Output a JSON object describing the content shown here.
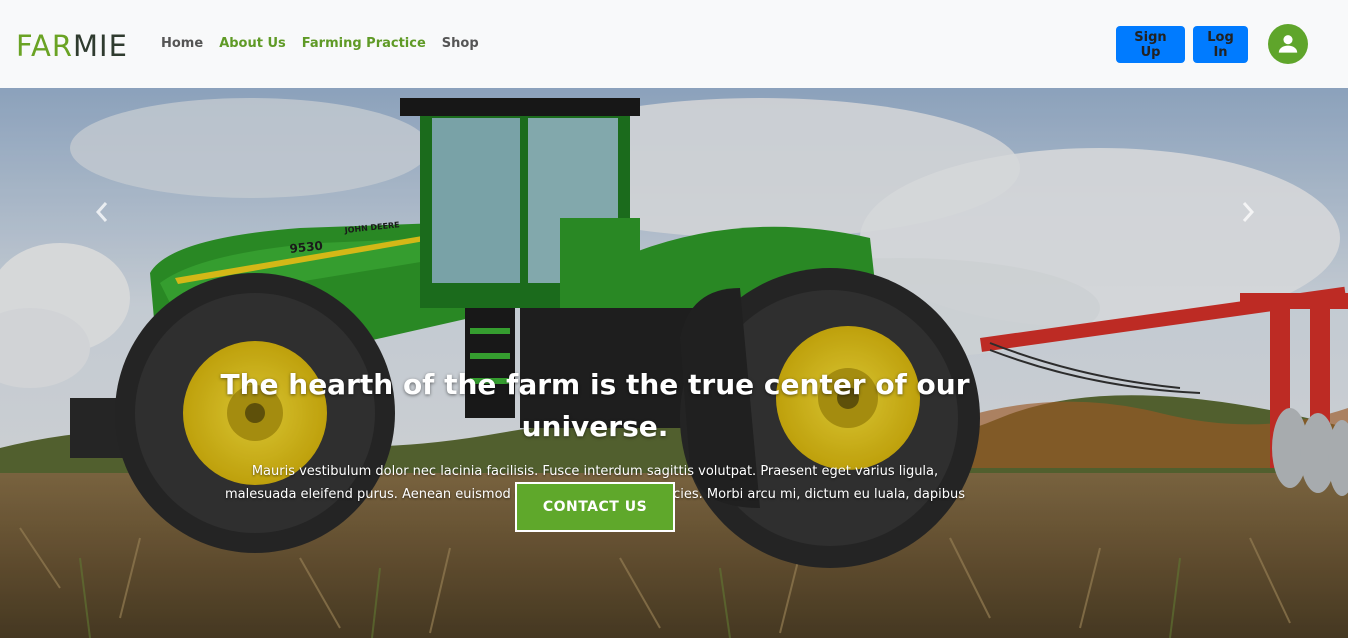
{
  "brand": {
    "part1": "FAR",
    "part2": "MIE"
  },
  "nav": {
    "links": [
      {
        "label": "Home"
      },
      {
        "label": "About Us"
      },
      {
        "label": "Farming Practice"
      },
      {
        "label": "Shop"
      }
    ],
    "signup_label": "Sign Up",
    "login_label": "Log In",
    "avatar_icon": "user-icon"
  },
  "hero": {
    "title": "The hearth of the farm is the true center of our universe.",
    "text": "Mauris vestibulum dolor nec lacinia facilisis. Fusce interdum sagittis volutpat. Praesent eget varius ligula, malesuada eleifend purus. Aenean euismod est at mauris mollis ultricies. Morbi arcu mi, dictum eu luala, dapibus interdum mollis.",
    "cta_label": "CONTACT US",
    "tractor_model": "9530",
    "tractor_brand": "JOHN DEERE",
    "prev_icon": "chevron-left-icon",
    "next_icon": "chevron-right-icon"
  },
  "colors": {
    "brand_green": "#6aa324",
    "cta_green": "#5fa82b",
    "button_blue": "#007bff",
    "tractor_green": "#2f9b2a",
    "wheel_yellow": "#f2d21b"
  }
}
